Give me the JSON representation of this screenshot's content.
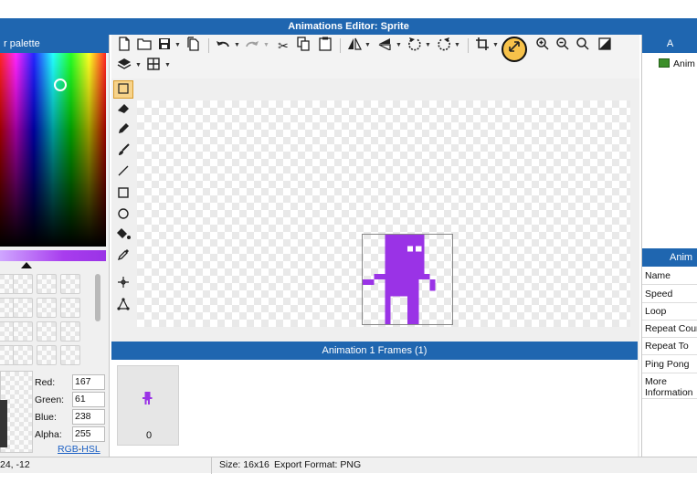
{
  "window": {
    "title": "Animations Editor: Sprite"
  },
  "color_panel": {
    "title": "r palette",
    "red_label": "Red:",
    "red_value": "167",
    "green_label": "Green:",
    "green_value": "61",
    "blue_label": "Blue:",
    "blue_value": "238",
    "alpha_label": "Alpha:",
    "alpha_value": "255",
    "rgb_link": "RGB",
    "separator": "-",
    "hsl_link": "HSL",
    "current_color": "#a73dee"
  },
  "toolbar": {
    "icons": [
      "new-file-icon",
      "open-folder-icon",
      "save-icon",
      "save-as-icon",
      "undo-icon",
      "redo-icon",
      "cut-icon",
      "copy-icon",
      "paste-icon",
      "flip-horizontal-icon",
      "flip-vertical-icon",
      "rotate-left-icon",
      "rotate-right-icon",
      "crop-icon",
      "resize-icon",
      "zoom-in-icon",
      "zoom-out-icon",
      "zoom-fit-icon",
      "background-icon",
      "layers-icon",
      "grid-icon"
    ]
  },
  "tools": [
    "select",
    "eraser",
    "pencil",
    "brush",
    "line",
    "rectangle",
    "ellipse",
    "fill",
    "eyedropper",
    "move",
    "transform"
  ],
  "frames_panel": {
    "title": "Animation 1 Frames (1)",
    "frame_label": "0"
  },
  "animations_panel": {
    "title": "A",
    "items": [
      {
        "label": "Anim"
      }
    ]
  },
  "properties_panel": {
    "title": "Anim",
    "rows": [
      "Name",
      "Speed",
      "Loop",
      "Repeat Cour",
      "Repeat To",
      "Ping Pong",
      "More Information"
    ]
  },
  "status": {
    "coords": "24, -12",
    "size": "Size: 16x16",
    "format": "Export Format: PNG"
  },
  "colors": {
    "accent": "#1f66b0",
    "sprite": "#9a33e6"
  }
}
